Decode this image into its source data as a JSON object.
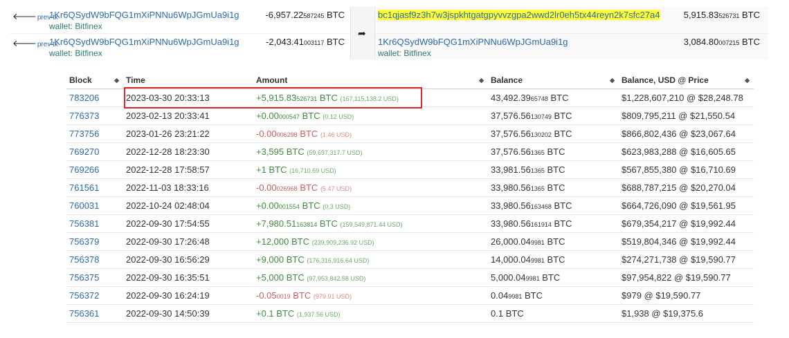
{
  "tx": {
    "inputs": [
      {
        "prev_label": "prev tx",
        "address": "1Kr6QSydW9bFQG1mXiPNNu6WpJGmUa9i1g",
        "wallet": "wallet: Bitfinex",
        "amount_main": "-6,957.22",
        "amount_small": "587245",
        "unit": "BTC"
      },
      {
        "prev_label": "prev tx",
        "address": "1Kr6QSydW9bFQG1mXiPNNu6WpJGmUa9i1g",
        "wallet": "wallet: Bitfinex",
        "amount_main": "-2,043.41",
        "amount_small": "003117",
        "unit": "BTC"
      }
    ],
    "outputs": [
      {
        "address": "bc1qjasf9z3h7w3jspkhtgatgpyvvzgpa2wwd2lr0eh5tx44reyn2k7sfc27a4",
        "wallet": "",
        "amount_main": "5,915.83",
        "amount_small": "526731",
        "unit": "BTC"
      },
      {
        "address": "1Kr6QSydW9bFQG1mXiPNNu6WpJGmUa9i1g",
        "wallet": "wallet: Bitfinex",
        "amount_main": "3,084.80",
        "amount_small": "007215",
        "unit": "BTC"
      }
    ],
    "arrow_icon": "arrow-right-icon",
    "prev_icon": "arrow-left-icon"
  },
  "table": {
    "headers": {
      "block": "Block",
      "time": "Time",
      "amount": "Amount",
      "balance": "Balance",
      "usd": "Balance, USD @ Price"
    },
    "rows": [
      {
        "block": "783206",
        "time": "2023-03-30 20:33:13",
        "amt_main": "+5,915.83",
        "amt_small": "526731",
        "amt_unit": "BTC",
        "amt_usd": "(167,115,138.2 USD)",
        "sign": "pos",
        "bal_main": "43,492.39",
        "bal_small": "65748",
        "bal_unit": "BTC",
        "usd": "$1,228,607,210 @ $28,248.78"
      },
      {
        "block": "776373",
        "time": "2023-02-13 20:33:41",
        "amt_main": "+0.00",
        "amt_small": "000547",
        "amt_unit": "BTC",
        "amt_usd": "(0.12 USD)",
        "sign": "pos",
        "bal_main": "37,576.56",
        "bal_small": "130749",
        "bal_unit": "BTC",
        "usd": "$809,795,211 @ $21,550.54"
      },
      {
        "block": "773756",
        "time": "2023-01-26 23:21:22",
        "amt_main": "-0.00",
        "amt_small": "006298",
        "amt_unit": "BTC",
        "amt_usd": "(1.46 USD)",
        "sign": "neg",
        "bal_main": "37,576.56",
        "bal_small": "130202",
        "bal_unit": "BTC",
        "usd": "$866,802,436 @ $23,067.64"
      },
      {
        "block": "769270",
        "time": "2022-12-28 18:23:30",
        "amt_main": "+3,595",
        "amt_small": "",
        "amt_unit": "BTC",
        "amt_usd": "(59,697,317.7 USD)",
        "sign": "pos",
        "bal_main": "37,576.56",
        "bal_small": "1365",
        "bal_unit": "BTC",
        "usd": "$623,983,288 @ $16,605.65"
      },
      {
        "block": "769266",
        "time": "2022-12-28 17:58:57",
        "amt_main": "+1",
        "amt_small": "",
        "amt_unit": "BTC",
        "amt_usd": "(16,710.69 USD)",
        "sign": "pos",
        "bal_main": "33,981.56",
        "bal_small": "1365",
        "bal_unit": "BTC",
        "usd": "$567,855,380 @ $16,710.69"
      },
      {
        "block": "761561",
        "time": "2022-11-03 18:33:16",
        "amt_main": "-0.00",
        "amt_small": "026968",
        "amt_unit": "BTC",
        "amt_usd": "(5.47 USD)",
        "sign": "neg",
        "bal_main": "33,980.56",
        "bal_small": "1365",
        "bal_unit": "BTC",
        "usd": "$688,787,215 @ $20,270.04"
      },
      {
        "block": "760031",
        "time": "2022-10-24 02:48:04",
        "amt_main": "+0.00",
        "amt_small": "001554",
        "amt_unit": "BTC",
        "amt_usd": "(0.3 USD)",
        "sign": "pos",
        "bal_main": "33,980.56",
        "bal_small": "163468",
        "bal_unit": "BTC",
        "usd": "$664,726,090 @ $19,561.95"
      },
      {
        "block": "756381",
        "time": "2022-09-30 17:54:55",
        "amt_main": "+7,980.51",
        "amt_small": "163814",
        "amt_unit": "BTC",
        "amt_usd": "(159,549,871.44 USD)",
        "sign": "pos",
        "bal_main": "33,980.56",
        "bal_small": "161914",
        "bal_unit": "BTC",
        "usd": "$679,354,217 @ $19,992.44"
      },
      {
        "block": "756379",
        "time": "2022-09-30 17:26:48",
        "amt_main": "+12,000",
        "amt_small": "",
        "amt_unit": "BTC",
        "amt_usd": "(239,909,236.92 USD)",
        "sign": "pos",
        "bal_main": "26,000.04",
        "bal_small": "9981",
        "bal_unit": "BTC",
        "usd": "$519,804,346 @ $19,992.44"
      },
      {
        "block": "756378",
        "time": "2022-09-30 16:56:29",
        "amt_main": "+9,000",
        "amt_small": "",
        "amt_unit": "BTC",
        "amt_usd": "(176,316,916.64 USD)",
        "sign": "pos",
        "bal_main": "14,000.04",
        "bal_small": "9981",
        "bal_unit": "BTC",
        "usd": "$274,271,738 @ $19,590.77"
      },
      {
        "block": "756375",
        "time": "2022-09-30 16:35:51",
        "amt_main": "+5,000",
        "amt_small": "",
        "amt_unit": "BTC",
        "amt_usd": "(97,953,842.58 USD)",
        "sign": "pos",
        "bal_main": "5,000.04",
        "bal_small": "9981",
        "bal_unit": "BTC",
        "usd": "$97,954,822 @ $19,590.77"
      },
      {
        "block": "756372",
        "time": "2022-09-30 16:24:19",
        "amt_main": "-0.05",
        "amt_small": "0019",
        "amt_unit": "BTC",
        "amt_usd": "(979.91 USD)",
        "sign": "neg",
        "bal_main": "0.04",
        "bal_small": "9981",
        "bal_unit": "BTC",
        "usd": "$979 @ $19,590.77"
      },
      {
        "block": "756361",
        "time": "2022-09-30 14:50:39",
        "amt_main": "+0.1",
        "amt_small": "",
        "amt_unit": "BTC",
        "amt_usd": "(1,937.56 USD)",
        "sign": "pos",
        "bal_main": "0.1",
        "bal_small": "",
        "bal_unit": "BTC",
        "usd": "$1,938 @ $19,375.6"
      }
    ]
  },
  "colors": {
    "link": "#2a6aad",
    "positive": "#3f8a3f",
    "negative": "#c85d5d",
    "highlight": "#ffff33",
    "annotation_box": "#e0272b",
    "wallet": "#2a7a6f"
  }
}
